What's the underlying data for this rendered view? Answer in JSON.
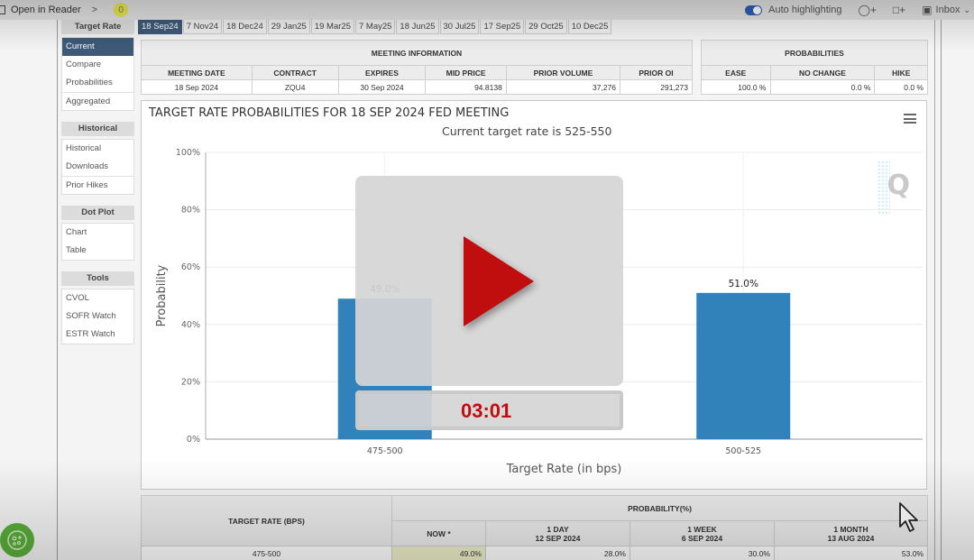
{
  "topbar": {
    "reader_label": "Open in Reader",
    "chevron": ">",
    "badge_count": "0",
    "auto_highlighting_label": "Auto highlighting",
    "auto_highlighting_on": true,
    "tag_icon": "tag-plus-icon",
    "comment_icon": "comment-plus-icon",
    "inbox_label": "Inbox"
  },
  "sidebar": {
    "groups": [
      {
        "heading": "Target Rate",
        "items": [
          "Current",
          "Compare",
          "Probabilities",
          "Aggregated"
        ],
        "active": "Current"
      },
      {
        "heading": "Historical",
        "items": [
          "Historical",
          "Downloads",
          "Prior Hikes"
        ]
      },
      {
        "heading": "Dot Plot",
        "items": [
          "Chart",
          "Table"
        ]
      },
      {
        "heading": "Tools",
        "items": [
          "CVOL",
          "SOFR Watch",
          "ESTR Watch"
        ]
      }
    ]
  },
  "tabs": [
    "18 Sep24",
    "7 Nov24",
    "18 Dec24",
    "29 Jan25",
    "19 Mar25",
    "7 May25",
    "18 Jun25",
    "30 Jul25",
    "17 Sep25",
    "29 Oct25",
    "10 Dec25"
  ],
  "active_tab": "18 Sep24",
  "meeting_info": {
    "title": "MEETING INFORMATION",
    "headers": [
      "MEETING DATE",
      "CONTRACT",
      "EXPIRES",
      "MID PRICE",
      "PRIOR VOLUME",
      "PRIOR OI"
    ],
    "row": [
      "18 Sep 2024",
      "ZQU4",
      "30 Sep 2024",
      "94.8138",
      "37,276",
      "291,273"
    ]
  },
  "probabilities": {
    "title": "PROBABILITIES",
    "headers": [
      "EASE",
      "NO CHANGE",
      "HIKE"
    ],
    "row": [
      "100.0 %",
      "0.0 %",
      "0.0 %"
    ]
  },
  "chart_data": {
    "type": "bar",
    "title": "TARGET RATE PROBABILITIES FOR 18 SEP 2024 FED MEETING",
    "subtitle": "Current target rate is 525-550",
    "categories": [
      "475-500",
      "500-525"
    ],
    "values": [
      49.0,
      51.0
    ],
    "data_labels": [
      "49.0%",
      "51.0%"
    ],
    "xlabel": "Target Rate (in bps)",
    "ylabel": "Probability",
    "ylim": [
      0,
      100
    ],
    "yticks": [
      "0%",
      "20%",
      "40%",
      "60%",
      "80%",
      "100%"
    ],
    "ytick_values": [
      0,
      20,
      40,
      60,
      80,
      100
    ],
    "grid": true,
    "bar_color": "#3182bb"
  },
  "video_overlay": {
    "time": "03:01",
    "play_color": "#c00e0e"
  },
  "bottom_table": {
    "col1_header": "TARGET RATE (BPS)",
    "group_header": "PROBABILITY(%)",
    "sub_headers": [
      {
        "line1": "NOW *",
        "line2": ""
      },
      {
        "line1": "1 DAY",
        "line2": "12 SEP 2024"
      },
      {
        "line1": "1 WEEK",
        "line2": "6 SEP 2024"
      },
      {
        "line1": "1 MONTH",
        "line2": "13 AUG 2024"
      }
    ],
    "rows": [
      [
        "475-500",
        "49.0%",
        "28.0%",
        "30.0%",
        "53.0%"
      ]
    ]
  }
}
